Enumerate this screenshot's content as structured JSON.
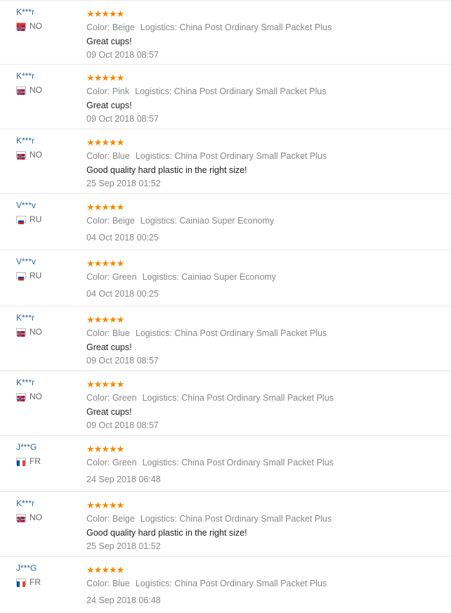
{
  "rating_stars": "★★★★★",
  "reviews": [
    {
      "user": "K***r",
      "country": "NO",
      "flag": "norway-flag-icon",
      "color": "Color: Beige",
      "logistics": "Logistics: China Post Ordinary Small Packet Plus",
      "text": "Great cups!",
      "date": "09 Oct 2018 08:57"
    },
    {
      "user": "K***r",
      "country": "NO",
      "flag": "norway-flag-icon",
      "color": "Color: Pink",
      "logistics": "Logistics: China Post Ordinary Small Packet Plus",
      "text": "Great cups!",
      "date": "09 Oct 2018 08:57"
    },
    {
      "user": "K***r",
      "country": "NO",
      "flag": "norway-flag-icon",
      "color": "Color: Blue",
      "logistics": "Logistics: China Post Ordinary Small Packet Plus",
      "text": "Good quality hard plastic in the right size!",
      "date": "25 Sep 2018 01:52"
    },
    {
      "user": "V***v",
      "country": "RU",
      "flag": "russia-flag-icon",
      "color": "Color: Beige",
      "logistics": "Logistics: Cainiao Super Economy",
      "text": "",
      "date": "04 Oct 2018 00:25"
    },
    {
      "user": "V***v",
      "country": "RU",
      "flag": "russia-flag-icon",
      "color": "Color: Green",
      "logistics": "Logistics: Cainiao Super Economy",
      "text": "",
      "date": "04 Oct 2018 00:25"
    },
    {
      "user": "K***r",
      "country": "NO",
      "flag": "norway-flag-icon",
      "color": "Color: Blue",
      "logistics": "Logistics: China Post Ordinary Small Packet Plus",
      "text": "Great cups!",
      "date": "09 Oct 2018 08:57"
    },
    {
      "user": "K***r",
      "country": "NO",
      "flag": "norway-flag-icon",
      "color": "Color: Green",
      "logistics": "Logistics: China Post Ordinary Small Packet Plus",
      "text": "Great cups!",
      "date": "09 Oct 2018 08:57"
    },
    {
      "user": "J***G",
      "country": "FR",
      "flag": "france-flag-icon",
      "color": "Color: Green",
      "logistics": "Logistics: China Post Ordinary Small Packet Plus",
      "text": "",
      "date": "24 Sep 2018 06:48"
    },
    {
      "user": "K***r",
      "country": "NO",
      "flag": "norway-flag-icon",
      "color": "Color: Beige",
      "logistics": "Logistics: China Post Ordinary Small Packet Plus",
      "text": "Good quality hard plastic in the right size!",
      "date": "25 Sep 2018 01:52"
    },
    {
      "user": "J***G",
      "country": "FR",
      "flag": "france-flag-icon",
      "color": "Color: Blue",
      "logistics": "Logistics: China Post Ordinary Small Packet Plus",
      "text": "",
      "date": "24 Sep 2018 06:48"
    }
  ]
}
